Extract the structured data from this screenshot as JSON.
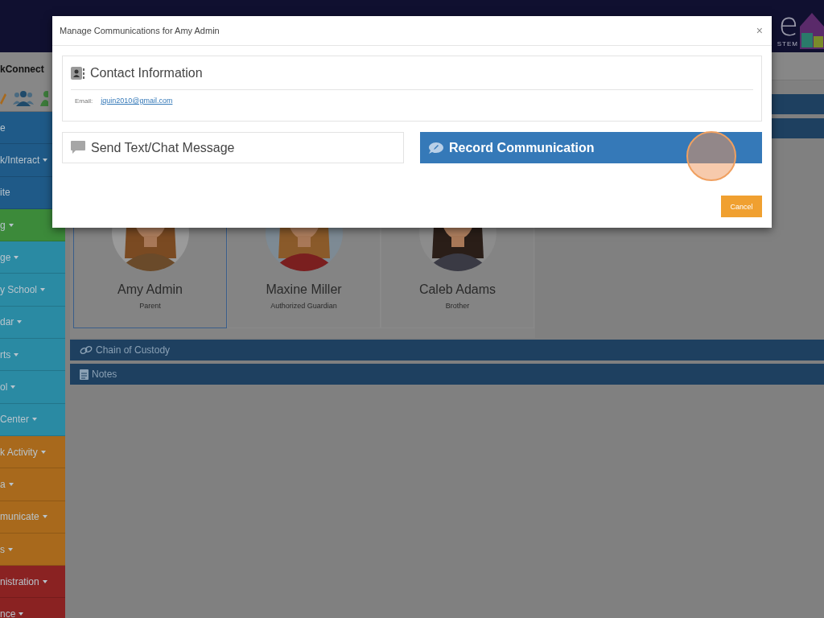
{
  "header": {
    "logo_fragment": "e",
    "logo_tagline_fragment": "STEM"
  },
  "sidebar": {
    "brand": "kConnect",
    "items": [
      {
        "label": "e",
        "color": "#1f5a88",
        "has_menu": false
      },
      {
        "label": "k/Interact",
        "color": "#1f5a88",
        "has_menu": true
      },
      {
        "label": "ite",
        "color": "#1f5a88",
        "has_menu": false
      },
      {
        "label": "g",
        "color": "#3c8a3a",
        "has_menu": true
      },
      {
        "label": "ge",
        "color": "#2a8aa3",
        "has_menu": true
      },
      {
        "label": "y School",
        "color": "#2a8aa3",
        "has_menu": true
      },
      {
        "label": "dar",
        "color": "#2a8aa3",
        "has_menu": true
      },
      {
        "label": "rts",
        "color": "#2a8aa3",
        "has_menu": true
      },
      {
        "label": "ol",
        "color": "#2a8aa3",
        "has_menu": true
      },
      {
        "label": "Center",
        "color": "#2a8aa3",
        "has_menu": true
      },
      {
        "label": "k Activity",
        "color": "#a8691c",
        "has_menu": true
      },
      {
        "label": "a",
        "color": "#a8691c",
        "has_menu": true
      },
      {
        "label": "municate",
        "color": "#a8691c",
        "has_menu": true
      },
      {
        "label": "s",
        "color": "#a8691c",
        "has_menu": true
      },
      {
        "label": "nistration",
        "color": "#8a2222",
        "has_menu": true
      },
      {
        "label": "nce",
        "color": "#8a2222",
        "has_menu": true
      }
    ]
  },
  "contacts": [
    {
      "name": "Amy Admin",
      "role": "Parent",
      "selected": true
    },
    {
      "name": "Maxine Miller",
      "role": "Authorized Guardian",
      "selected": false
    },
    {
      "name": "Caleb Adams",
      "role": "Brother",
      "selected": false
    }
  ],
  "sections": [
    {
      "title": "Chain of Custody"
    },
    {
      "title": "Notes"
    }
  ],
  "modal": {
    "title": "Manage Communications for Amy Admin",
    "close": "×",
    "contact_info": {
      "title": "Contact Information",
      "email_label": "Email:",
      "email": "jquin2010@gmail.com"
    },
    "actions": [
      {
        "label": "Send Text/Chat Message",
        "kind": "default"
      },
      {
        "label": "Record Communication",
        "kind": "primary"
      }
    ],
    "cancel": "Cancel"
  }
}
